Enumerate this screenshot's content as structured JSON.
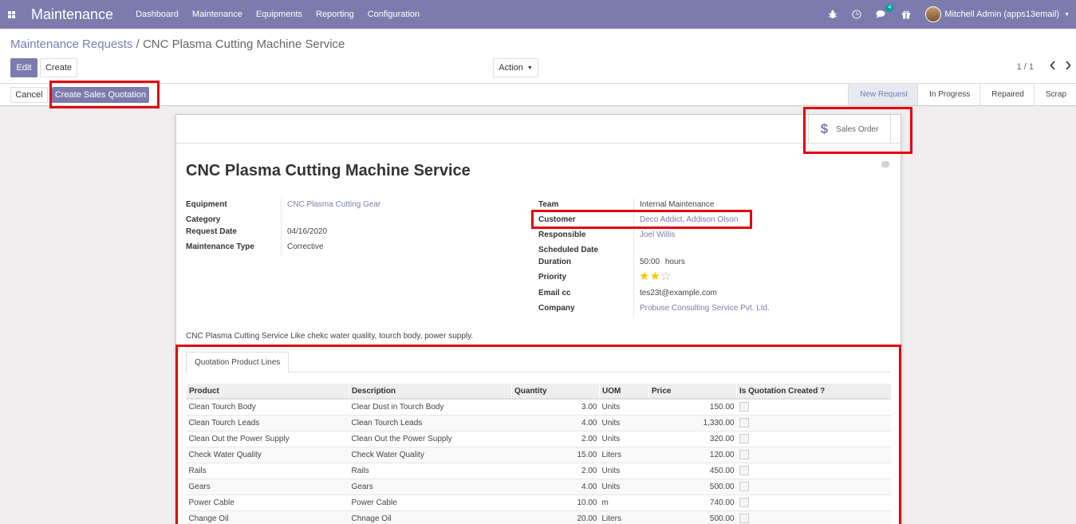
{
  "navbar": {
    "app_name": "Maintenance",
    "menu": [
      "Dashboard",
      "Maintenance",
      "Equipments",
      "Reporting",
      "Configuration"
    ],
    "messages_badge": "4",
    "user": "Mitchell Admin (apps13email)"
  },
  "breadcrumb": {
    "parent": "Maintenance Requests",
    "separator": "/",
    "current": "CNC Plasma Cutting Machine Service"
  },
  "buttons": {
    "edit": "Edit",
    "create": "Create",
    "action": "Action",
    "cancel": "Cancel",
    "create_sales_quotation": "Create Sales Quotation"
  },
  "pager": {
    "value": "1 / 1"
  },
  "stages": [
    "New Request",
    "In Progress",
    "Repaired",
    "Scrap"
  ],
  "active_stage": "New Request",
  "smart_button": {
    "label": "Sales Order"
  },
  "record": {
    "title": "CNC Plasma Cutting Machine Service",
    "left": {
      "equipment_label": "Equipment",
      "equipment": "CNC Plasma Cutting Gear",
      "category_label": "Category",
      "category": "",
      "request_date_label": "Request Date",
      "request_date": "04/16/2020",
      "maintenance_type_label": "Maintenance Type",
      "maintenance_type": "Corrective"
    },
    "right": {
      "team_label": "Team",
      "team": "Internal Maintenance",
      "customer_label": "Customer",
      "customer": "Deco Addict, Addison Olson",
      "responsible_label": "Responsible",
      "responsible": "Joel Willis",
      "scheduled_date_label": "Scheduled Date",
      "scheduled_date": "",
      "duration_label": "Duration",
      "duration": "50:00",
      "duration_unit": "hours",
      "priority_label": "Priority",
      "priority_stars": 2,
      "priority_max": 3,
      "email_cc_label": "Email cc",
      "email_cc": "tes23t@example.com",
      "company_label": "Company",
      "company": "Probuse Consulting Service Pvt. Ltd."
    },
    "description": "CNC Plasma Cutting Service Like chekc water quality, tourch body, power supply."
  },
  "tab": {
    "label": "Quotation Product Lines"
  },
  "lines": {
    "headers": [
      "Product",
      "Description",
      "Quantity",
      "UOM",
      "Price",
      "Is Quotation Created ?"
    ],
    "rows": [
      [
        "Clean Tourch Body",
        "Clear Dust in Tourch Body",
        "3.00",
        "Units",
        "150.00"
      ],
      [
        "Clean Tourch Leads",
        "Clean Tourch Leads",
        "4.00",
        "Units",
        "1,330.00"
      ],
      [
        "Clean Out the Power Supply",
        "Clean Out the Power Supply",
        "2.00",
        "Units",
        "320.00"
      ],
      [
        "Check Water Quality",
        "Check Water Quality",
        "15.00",
        "Liters",
        "120.00"
      ],
      [
        "Rails",
        "Rails",
        "2.00",
        "Units",
        "450.00"
      ],
      [
        "Gears",
        "Gears",
        "4.00",
        "Units",
        "500.00"
      ],
      [
        "Power Cable",
        "Power Cable",
        "10.00",
        "m",
        "740.00"
      ],
      [
        "Change Oil",
        "Chnage Oil",
        "20.00",
        "Liters",
        "500.00"
      ]
    ]
  },
  "colors": {
    "brand": "#7c7bad",
    "highlight": "#e3000f",
    "star": "#f3cc00"
  }
}
